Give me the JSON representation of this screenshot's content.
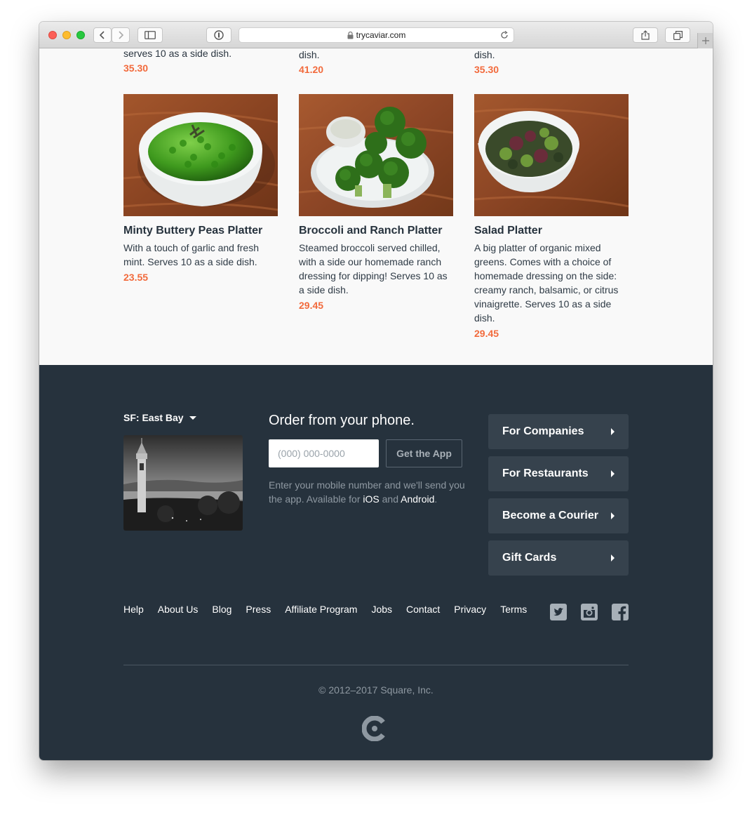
{
  "browser": {
    "url": "trycaviar.com"
  },
  "top_row": [
    {
      "desc": "serves 10 as a side dish.",
      "price": "35.30"
    },
    {
      "desc": "dish.",
      "price": "41.20"
    },
    {
      "desc": "dish.",
      "price": "35.30"
    }
  ],
  "menu_items": [
    {
      "title": "Minty Buttery Peas Platter",
      "desc": "With a touch of garlic and fresh mint. Serves 10 as a side dish.",
      "price": "23.55"
    },
    {
      "title": "Broccoli and Ranch Platter",
      "desc": "Steamed broccoli served chilled, with a side our homemade ranch dressing for dipping! Serves 10 as a side dish.",
      "price": "29.45"
    },
    {
      "title": "Salad Platter",
      "desc": "A big platter of organic mixed greens. Comes with a choice of homemade dressing on the side: creamy ranch, balsamic, or citrus vinaigrette. Serves 10 as a side dish.",
      "price": "29.45"
    }
  ],
  "footer": {
    "region": "SF: East Bay",
    "order_heading": "Order from your phone.",
    "phone_placeholder": "(000) 000-0000",
    "get_app_label": "Get the App",
    "note_prefix": "Enter your mobile number and we'll send you the app. Available for ",
    "ios": "iOS",
    "and": " and ",
    "android": "Android",
    "period": ".",
    "side_buttons": [
      "For Companies",
      "For Restaurants",
      "Become a Courier",
      "Gift Cards"
    ],
    "links": [
      "Help",
      "About Us",
      "Blog",
      "Press",
      "Affiliate Program",
      "Jobs",
      "Contact",
      "Privacy",
      "Terms"
    ],
    "social_icons": [
      "twitter-icon",
      "instagram-icon",
      "facebook-icon"
    ],
    "copyright": "© 2012–2017 Square, Inc."
  },
  "colors": {
    "accent_price": "#f26a3c",
    "footer_bg": "#26323d",
    "footer_button_bg": "#36424d"
  }
}
